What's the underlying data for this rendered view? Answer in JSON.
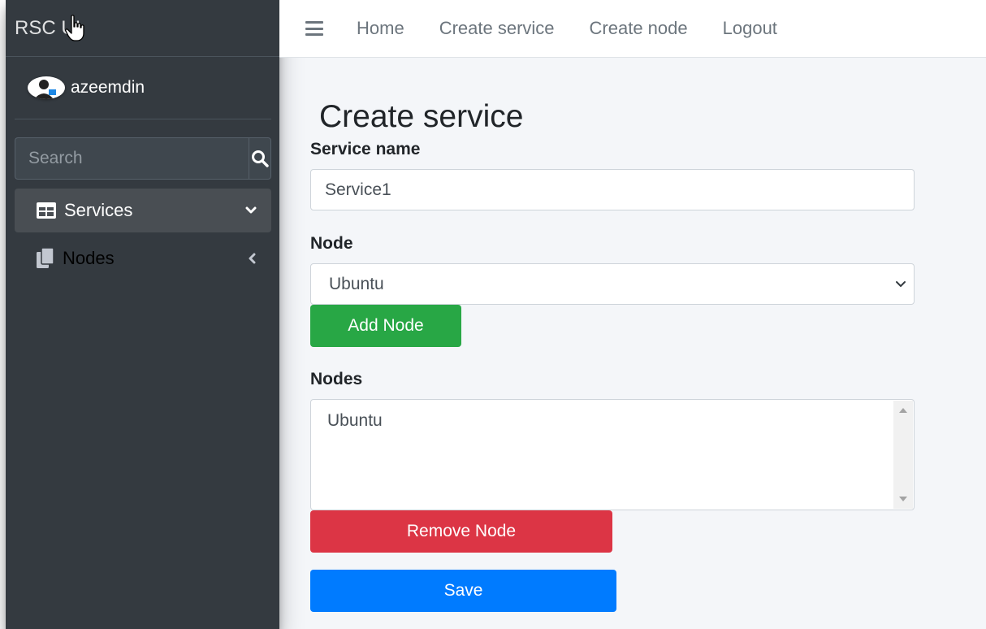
{
  "sidebar": {
    "brand": "RSC UI",
    "user_name": "azeemdin",
    "search_placeholder": "Search",
    "items": [
      {
        "label": "Services",
        "icon": "table-icon",
        "active": true
      },
      {
        "label": "Nodes",
        "icon": "copy-icon",
        "active": false
      }
    ]
  },
  "topbar": {
    "links": [
      "Home",
      "Create service",
      "Create node",
      "Logout"
    ]
  },
  "form": {
    "title": "Create service",
    "service_name_label": "Service name",
    "service_name_value": "Service1",
    "node_label": "Node",
    "node_selected": "Ubuntu",
    "add_node_label": "Add Node",
    "nodes_label": "Nodes",
    "nodes_list": [
      "Ubuntu"
    ],
    "remove_node_label": "Remove Node",
    "save_label": "Save"
  },
  "colors": {
    "sidebar_bg": "#343a40",
    "content_bg": "#f4f6f9",
    "success": "#28a745",
    "danger": "#dc3545",
    "primary": "#007bff"
  }
}
